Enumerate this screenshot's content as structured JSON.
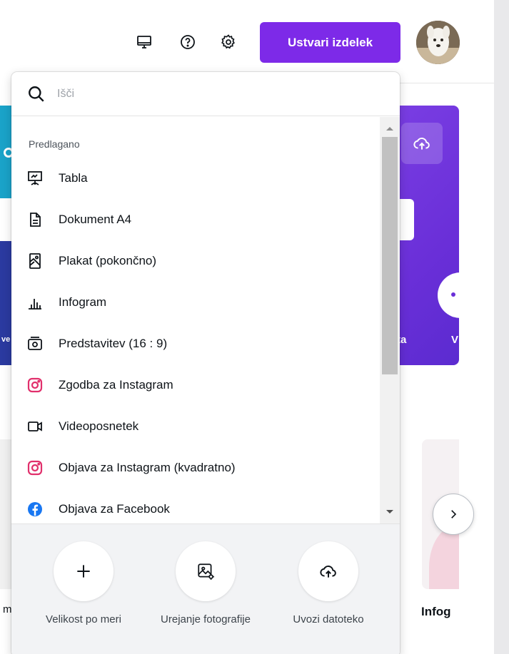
{
  "header": {
    "create_button": "Ustvari izdelek",
    "icons": [
      "desktop-icon",
      "help-icon",
      "settings-icon"
    ]
  },
  "background": {
    "partial_text_right_1": "ta",
    "partial_text_right_2": "V",
    "partial_text_left": "ve",
    "card_label_right": "Infog",
    "card_label_left": "m"
  },
  "dropdown": {
    "search": {
      "placeholder": "Išči",
      "value": ""
    },
    "section_title": "Predlagano",
    "items": [
      {
        "label": "Tabla",
        "icon": "whiteboard-icon"
      },
      {
        "label": "Dokument A4",
        "icon": "document-icon"
      },
      {
        "label": "Plakat (pokončno)",
        "icon": "poster-icon"
      },
      {
        "label": "Infogram",
        "icon": "bar-chart-icon"
      },
      {
        "label": "Predstavitev (16 : 9)",
        "icon": "presentation-icon"
      },
      {
        "label": "Zgodba za Instagram",
        "icon": "instagram-icon"
      },
      {
        "label": "Videoposnetek",
        "icon": "video-camera-icon"
      },
      {
        "label": "Objava za Instagram (kvadratno)",
        "icon": "instagram-icon"
      },
      {
        "label": "Objava za Facebook",
        "icon": "facebook-icon"
      }
    ],
    "actions": [
      {
        "label": "Velikost po meri",
        "icon": "plus-icon"
      },
      {
        "label": "Urejanje fotografije",
        "icon": "edit-photo-icon"
      },
      {
        "label": "Uvozi datoteko",
        "icon": "upload-cloud-icon"
      }
    ]
  },
  "colors": {
    "accent": "#7d2ae8",
    "instagram": "#e1306c",
    "facebook": "#1877f2"
  }
}
